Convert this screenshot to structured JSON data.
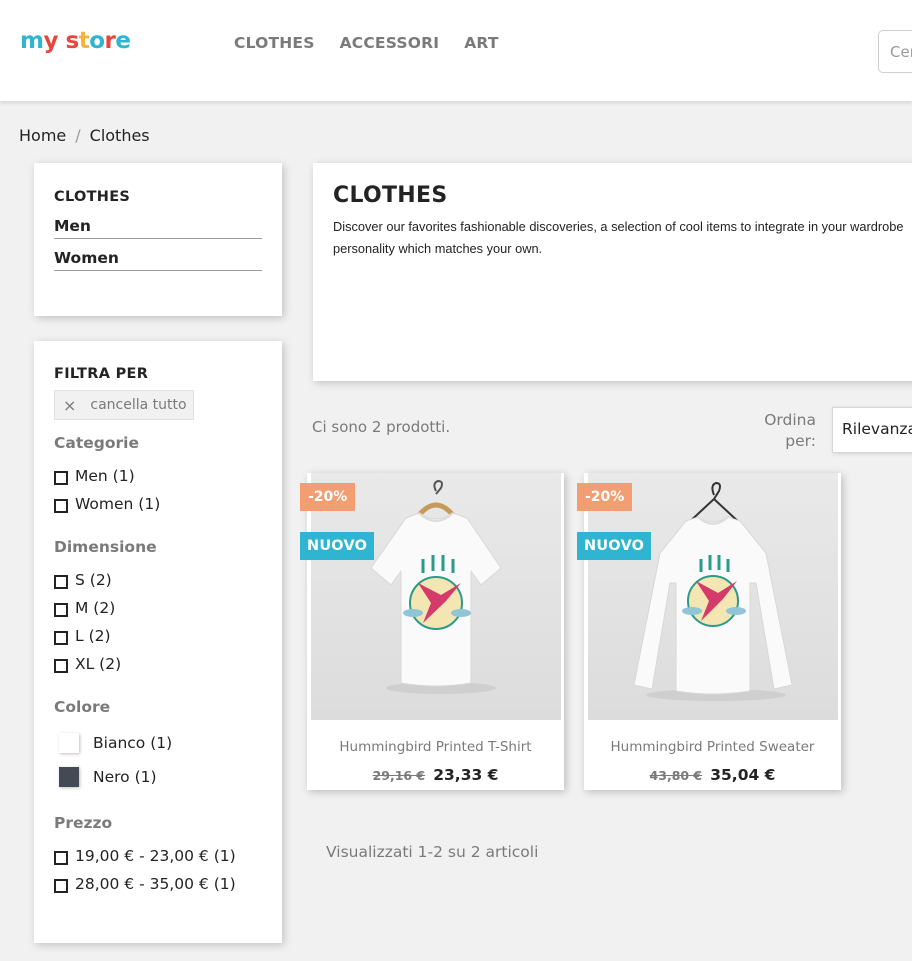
{
  "header": {
    "logo": {
      "parts": [
        "m",
        "y",
        " ",
        "s",
        "t",
        "o",
        "r",
        "e"
      ]
    },
    "nav": [
      "CLOTHES",
      "ACCESSORI",
      "ART"
    ],
    "search_placeholder": "Cerca"
  },
  "breadcrumb": {
    "home": "Home",
    "separator": "/",
    "current": "Clothes"
  },
  "category_block": {
    "title": "CLOTHES",
    "links": [
      "Men",
      "Women"
    ]
  },
  "filters": {
    "title": "FILTRA PER",
    "clear_all": "cancella tutto",
    "clear_icon": "×",
    "categorie": {
      "title": "Categorie",
      "items": [
        "Men (1)",
        "Women (1)"
      ]
    },
    "dimensione": {
      "title": "Dimensione",
      "items": [
        "S (2)",
        "M (2)",
        "L (2)",
        "XL (2)"
      ]
    },
    "colore": {
      "title": "Colore",
      "items": [
        {
          "label": "Bianco (1)",
          "color": "#ffffff"
        },
        {
          "label": "Nero (1)",
          "color": "#434a54"
        }
      ]
    },
    "prezzo": {
      "title": "Prezzo",
      "items": [
        "19,00 € - 23,00 € (1)",
        "28,00 € - 35,00 € (1)"
      ]
    }
  },
  "category_description": {
    "title": "CLOTHES",
    "line1": "Discover our favorites fashionable discoveries, a selection of cool items to integrate in your wardrobe",
    "line2": "personality which matches your own."
  },
  "listing": {
    "count": "Ci sono 2 prodotti.",
    "sort_label": "Ordina per:",
    "sort_value": "Rilevanza",
    "pagination": "Visualizzati 1-2 su 2 articoli"
  },
  "products": [
    {
      "name": "Hummingbird Printed T-Shirt",
      "old_price": "29,16 €",
      "price": "23,33 €",
      "discount": "-20%",
      "flag": "NUOVO"
    },
    {
      "name": "Hummingbird Printed Sweater",
      "old_price": "43,80 €",
      "price": "35,04 €",
      "discount": "-20%",
      "flag": "NUOVO"
    }
  ],
  "colors": {
    "discount_badge": "#f39d72",
    "new_badge": "#2fb5d2",
    "logo": [
      "#2fb5d2",
      "#e6473c",
      "#2fb5d2",
      "#e6473c",
      "#f4b43c",
      "#2fb5d2",
      "#e6473c",
      "#2fb5d2"
    ]
  }
}
